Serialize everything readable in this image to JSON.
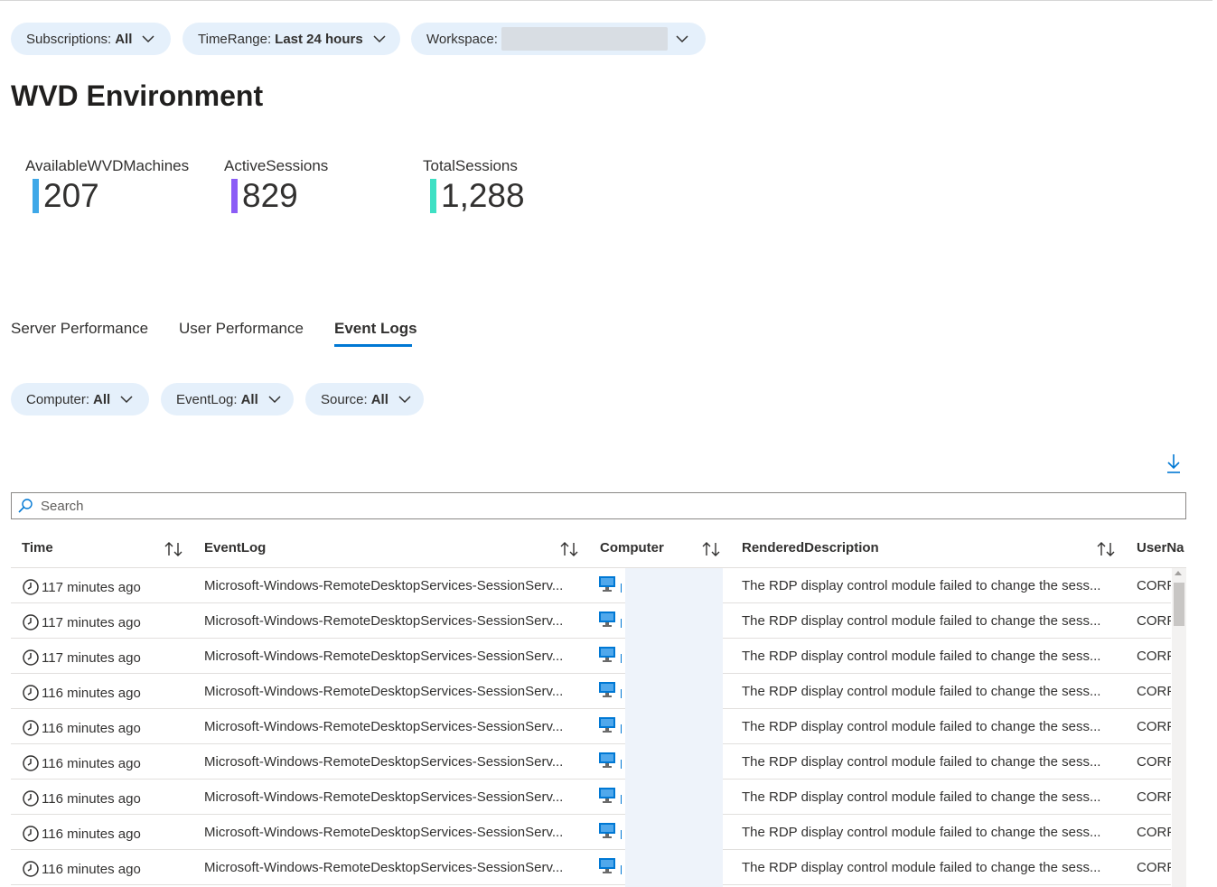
{
  "filters": {
    "subscriptions": {
      "label": "Subscriptions:",
      "value": "All"
    },
    "timerange": {
      "label": "TimeRange:",
      "value": "Last 24 hours"
    },
    "workspace": {
      "label": "Workspace:",
      "value": ""
    }
  },
  "page_title": "WVD Environment",
  "tiles": [
    {
      "label": "AvailableWVDMachines",
      "value": "207",
      "color": "#3ea8e8"
    },
    {
      "label": "ActiveSessions",
      "value": "829",
      "color": "#8b5cf6"
    },
    {
      "label": "TotalSessions",
      "value": "1,288",
      "color": "#3ee0c4"
    }
  ],
  "tabs": [
    {
      "label": "Server Performance",
      "active": false
    },
    {
      "label": "User Performance",
      "active": false
    },
    {
      "label": "Event Logs",
      "active": true
    }
  ],
  "sub_filters": {
    "computer": {
      "label": "Computer:",
      "value": "All"
    },
    "eventlog": {
      "label": "EventLog:",
      "value": "All"
    },
    "source": {
      "label": "Source:",
      "value": "All"
    }
  },
  "search": {
    "placeholder": "Search"
  },
  "table": {
    "columns": [
      "Time",
      "EventLog",
      "Computer",
      "RenderedDescription",
      "UserNa"
    ],
    "rows": [
      {
        "time": "117 minutes ago",
        "eventlog": "Microsoft-Windows-RemoteDesktopServices-SessionServ...",
        "computer": "",
        "description": "The RDP display control module failed to change the sess...",
        "user": "CORP"
      },
      {
        "time": "117 minutes ago",
        "eventlog": "Microsoft-Windows-RemoteDesktopServices-SessionServ...",
        "computer": "",
        "description": "The RDP display control module failed to change the sess...",
        "user": "CORP"
      },
      {
        "time": "117 minutes ago",
        "eventlog": "Microsoft-Windows-RemoteDesktopServices-SessionServ...",
        "computer": "",
        "description": "The RDP display control module failed to change the sess...",
        "user": "CORP"
      },
      {
        "time": "116 minutes ago",
        "eventlog": "Microsoft-Windows-RemoteDesktopServices-SessionServ...",
        "computer": "",
        "description": "The RDP display control module failed to change the sess...",
        "user": "CORP"
      },
      {
        "time": "116 minutes ago",
        "eventlog": "Microsoft-Windows-RemoteDesktopServices-SessionServ...",
        "computer": "",
        "description": "The RDP display control module failed to change the sess...",
        "user": "CORP"
      },
      {
        "time": "116 minutes ago",
        "eventlog": "Microsoft-Windows-RemoteDesktopServices-SessionServ...",
        "computer": "",
        "description": "The RDP display control module failed to change the sess...",
        "user": "CORP"
      },
      {
        "time": "116 minutes ago",
        "eventlog": "Microsoft-Windows-RemoteDesktopServices-SessionServ...",
        "computer": "",
        "description": "The RDP display control module failed to change the sess...",
        "user": "CORP"
      },
      {
        "time": "116 minutes ago",
        "eventlog": "Microsoft-Windows-RemoteDesktopServices-SessionServ...",
        "computer": "",
        "description": "The RDP display control module failed to change the sess...",
        "user": "CORP"
      },
      {
        "time": "116 minutes ago",
        "eventlog": "Microsoft-Windows-RemoteDesktopServices-SessionServ...",
        "computer": "",
        "description": "The RDP display control module failed to change the sess...",
        "user": "CORP"
      }
    ]
  },
  "colors": {
    "accent": "#0078d4",
    "pill_bg": "#e5f0fb"
  },
  "icons": {
    "chevron": "chevron-down-icon",
    "download": "download-icon",
    "search": "search-icon",
    "clock": "clock-icon",
    "computer": "computer-icon",
    "sort": "sort-icon"
  }
}
